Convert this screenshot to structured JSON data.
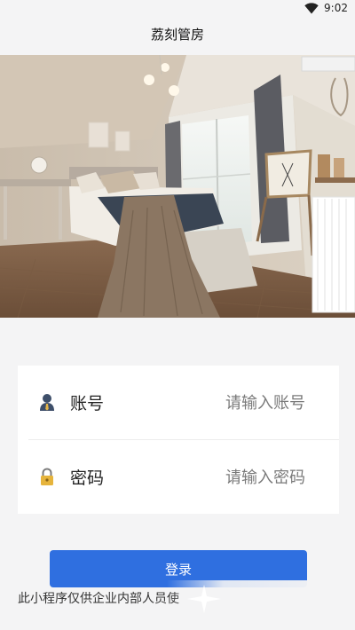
{
  "status_bar": {
    "time": "9:02",
    "wifi_icon": "wifi-icon"
  },
  "header": {
    "title": "荔刻管房"
  },
  "hero": {
    "image": "bedroom-photo"
  },
  "login": {
    "account": {
      "label": "账号",
      "placeholder": "请输入账号",
      "value": "",
      "icon": "user-icon"
    },
    "password": {
      "label": "密码",
      "placeholder": "请输入密码",
      "value": "",
      "icon": "lock-icon"
    },
    "submit_label": "登录"
  },
  "footer": {
    "notice": "此小程序仅供企业内部人员使"
  },
  "colors": {
    "primary": "#2f6fe0",
    "background": "#f4f4f5",
    "card": "#ffffff"
  }
}
